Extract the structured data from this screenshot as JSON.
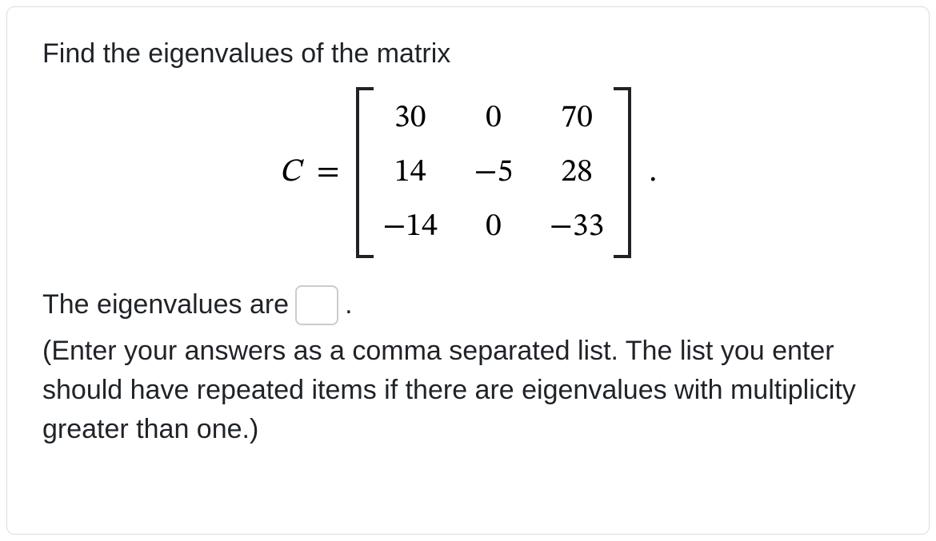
{
  "prompt_line1": "Find the eigenvalues of the matrix",
  "matrix_var": "C",
  "equals": "=",
  "matrix": {
    "r1c1": "30",
    "r1c2": "0",
    "r1c3": "70",
    "r2c1": "14",
    "r2c2": "−5",
    "r2c3": "28",
    "r3c1": "−14",
    "r3c2": "0",
    "r3c3": "−33"
  },
  "matrix_period": ".",
  "answer_label": "The eigenvalues are",
  "answer_period": ".",
  "answer_value": "",
  "hint": "(Enter your answers as a comma separated list. The list you enter should have repeated items if there are eigenvalues with multiplicity greater than one.)"
}
